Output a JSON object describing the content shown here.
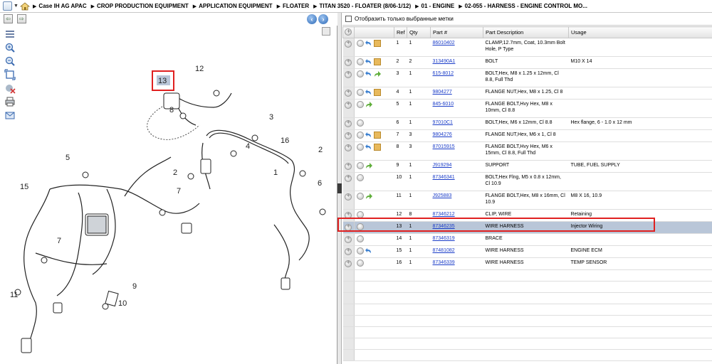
{
  "breadcrumb": [
    "Case IH AG APAC",
    "CROP PRODUCTION EQUIPMENT",
    "APPLICATION EQUIPMENT",
    "FLOATER",
    "TITAN 3520 - FLOATER (8/06-1/12)",
    "01 - ENGINE",
    "02-055 - HARNESS - ENGINE CONTROL MO..."
  ],
  "filter_label": "Отобразить только выбранные метки",
  "columns": [
    "Ref",
    "Qty",
    "Part #",
    "Part Description",
    "Usage"
  ],
  "rows": [
    {
      "ref": "1",
      "qty": "1",
      "part": "86010402",
      "desc": "CLAMP,12.7mm, Coat, 10.3mm Bolt Hole, P Type",
      "usage": "",
      "icons": [
        "back",
        "box"
      ]
    },
    {
      "ref": "2",
      "qty": "2",
      "part": "313490A1",
      "desc": "BOLT",
      "usage": "M10 X 14",
      "icons": [
        "back",
        "box"
      ]
    },
    {
      "ref": "3",
      "qty": "1",
      "part": "615-8012",
      "desc": "BOLT,Hex, M8 x 1.25 x 12mm, Cl 8.8, Full Thd",
      "usage": "",
      "icons": [
        "back",
        "go"
      ]
    },
    {
      "ref": "4",
      "qty": "1",
      "part": "9804277",
      "desc": "FLANGE NUT,Hex, M8 x 1.25, Cl 8",
      "usage": "",
      "icons": [
        "back",
        "box"
      ]
    },
    {
      "ref": "5",
      "qty": "1",
      "part": "845-6010",
      "desc": "FLANGE BOLT,Hvy Hex, M8 x 10mm, Cl 8.8",
      "usage": "",
      "icons": [
        "go"
      ]
    },
    {
      "ref": "6",
      "qty": "1",
      "part": "97010C1",
      "desc": "BOLT,Hex, M6 x 12mm, Cl 8.8",
      "usage": "Hex flange, 6 - 1.0 x 12 mm",
      "icons": []
    },
    {
      "ref": "7",
      "qty": "3",
      "part": "9804276",
      "desc": "FLANGE NUT,Hex, M6 x 1, Cl 8",
      "usage": "",
      "icons": [
        "back",
        "box"
      ]
    },
    {
      "ref": "8",
      "qty": "3",
      "part": "87015915",
      "desc": "FLANGE BOLT,Hvy Hex, M6 x 15mm, Cl 8.8, Full Thd",
      "usage": "",
      "icons": [
        "back",
        "box"
      ]
    },
    {
      "ref": "9",
      "qty": "1",
      "part": "J919294",
      "desc": "SUPPORT",
      "usage": "TUBE, FUEL SUPPLY",
      "icons": [
        "go"
      ]
    },
    {
      "ref": "10",
      "qty": "1",
      "part": "87346341",
      "desc": "BOLT,Hex Flng, M5 x 0.8 x 12mm, Cl 10.9",
      "usage": "",
      "icons": []
    },
    {
      "ref": "11",
      "qty": "1",
      "part": "J925883",
      "desc": "FLANGE BOLT,Hex, M8 x 16mm, Cl 10.9",
      "usage": "M8 X 16, 10.9",
      "icons": [
        "go"
      ]
    },
    {
      "ref": "12",
      "qty": "8",
      "part": "87346212",
      "desc": "CLIP, WIRE",
      "usage": "Retaining",
      "icons": []
    },
    {
      "ref": "13",
      "qty": "1",
      "part": "87346235",
      "desc": "WIRE HARNESS",
      "usage": "Injector Wiring",
      "icons": [],
      "selected": true
    },
    {
      "ref": "14",
      "qty": "1",
      "part": "87346319",
      "desc": "BRACE",
      "usage": "",
      "icons": []
    },
    {
      "ref": "15",
      "qty": "1",
      "part": "87481082",
      "desc": "WIRE HARNESS",
      "usage": "ENGINE ECM",
      "icons": [
        "back"
      ]
    },
    {
      "ref": "16",
      "qty": "1",
      "part": "87346339",
      "desc": "WIRE HARNESS",
      "usage": "TEMP SENSOR",
      "icons": []
    }
  ],
  "callouts": [
    "13",
    "12",
    "8",
    "3",
    "4",
    "16",
    "2",
    "1",
    "6",
    "5",
    "2",
    "7",
    "15",
    "7",
    "11",
    "10",
    "9"
  ],
  "toolbar_icons": [
    "zoom-in-icon",
    "zoom-out-icon",
    "fit-icon",
    "hide-icon",
    "print-icon",
    "email-icon"
  ]
}
